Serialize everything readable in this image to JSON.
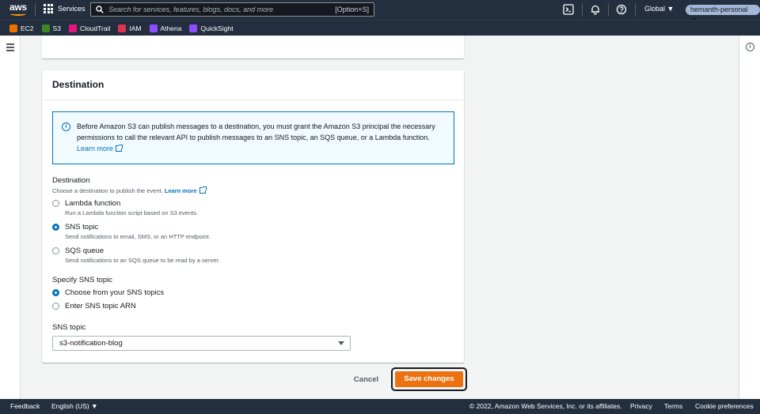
{
  "topnav": {
    "logo": "aws",
    "services_label": "Services",
    "search_placeholder": "Search for services, features, blogs, docs, and more",
    "search_shortcut": "[Option+S]",
    "region": "Global ▼",
    "account": "hemanth-personal ▼",
    "icons": [
      "cloudshell-icon",
      "bell-icon",
      "help-icon"
    ]
  },
  "favorites": [
    {
      "label": "EC2",
      "color": "#ed7100"
    },
    {
      "label": "S3",
      "color": "#3f8624"
    },
    {
      "label": "CloudTrail",
      "color": "#e7157b"
    },
    {
      "label": "IAM",
      "color": "#dd344c"
    },
    {
      "label": "Athena",
      "color": "#8c4fff"
    },
    {
      "label": "QuickSight",
      "color": "#8c4fff"
    }
  ],
  "destination": {
    "title": "Destination",
    "alert_text": "Before Amazon S3 can publish messages to a destination, you must grant the Amazon S3 principal the necessary permissions to call the relevant API to publish messages to an SNS topic, an SQS queue, or a Lambda function.",
    "alert_link": "Learn more",
    "field_label": "Destination",
    "field_desc": "Choose a destination to publish the event.",
    "field_link": "Learn more",
    "options": [
      {
        "label": "Lambda function",
        "desc": "Run a Lambda function script based on S3 events.",
        "selected": false
      },
      {
        "label": "SNS topic",
        "desc": "Send notifications to email, SMS, or an HTTP endpoint.",
        "selected": true
      },
      {
        "label": "SQS queue",
        "desc": "Send notifications to an SQS queue to be read by a server.",
        "selected": false
      }
    ],
    "specify_label": "Specify SNS topic",
    "specify_options": [
      {
        "label": "Choose from your SNS topics",
        "selected": true
      },
      {
        "label": "Enter SNS topic ARN",
        "selected": false
      }
    ],
    "sns_topic_label": "SNS topic",
    "sns_topic_value": "s3-notification-blog"
  },
  "actions": {
    "cancel": "Cancel",
    "save": "Save changes"
  },
  "footer": {
    "feedback": "Feedback",
    "language": "English (US) ▼",
    "copyright": "© 2022, Amazon Web Services, Inc. or its affiliates.",
    "privacy": "Privacy",
    "terms": "Terms",
    "cookies": "Cookie preferences"
  }
}
